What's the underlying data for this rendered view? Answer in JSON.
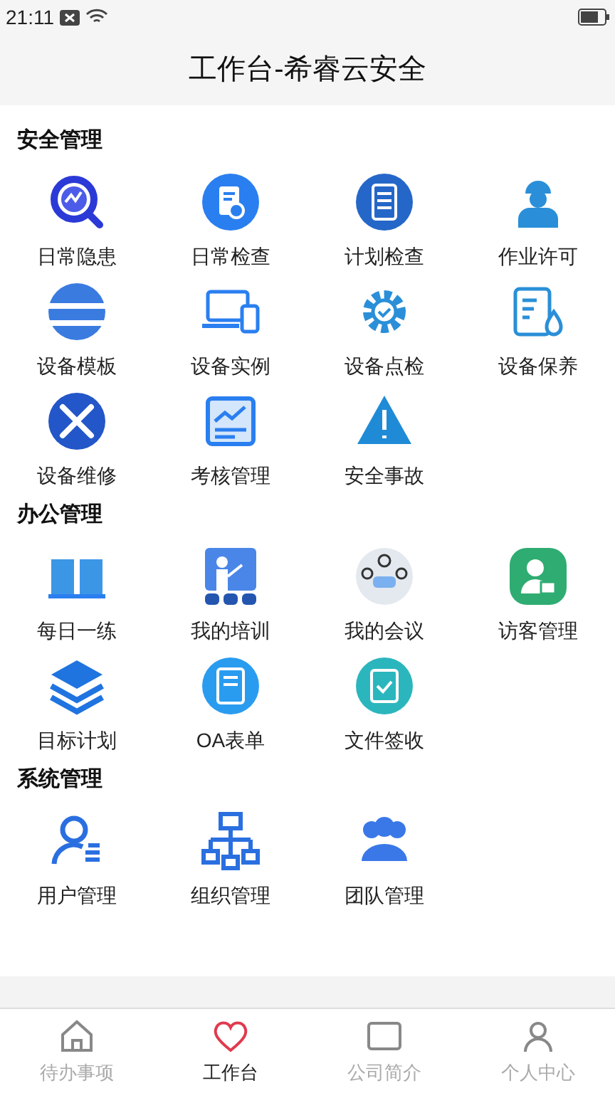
{
  "status_bar": {
    "time": "21:11"
  },
  "header": {
    "title": "工作台-希睿云安全"
  },
  "sections": [
    {
      "title": "安全管理",
      "items": [
        "日常隐患",
        "日常检查",
        "计划检查",
        "作业许可",
        "设备模板",
        "设备实例",
        "设备点检",
        "设备保养",
        "设备维修",
        "考核管理",
        "安全事故"
      ]
    },
    {
      "title": "办公管理",
      "items": [
        "每日一练",
        "我的培训",
        "我的会议",
        "访客管理",
        "目标计划",
        "OA表单",
        "文件签收"
      ]
    },
    {
      "title": "系统管理",
      "items": [
        "用户管理",
        "组织管理",
        "团队管理"
      ]
    }
  ],
  "bottom_nav": [
    {
      "label": "待办事项",
      "selected": false
    },
    {
      "label": "工作台",
      "selected": true
    },
    {
      "label": "公司简介",
      "selected": false
    },
    {
      "label": "个人中心",
      "selected": false
    }
  ]
}
